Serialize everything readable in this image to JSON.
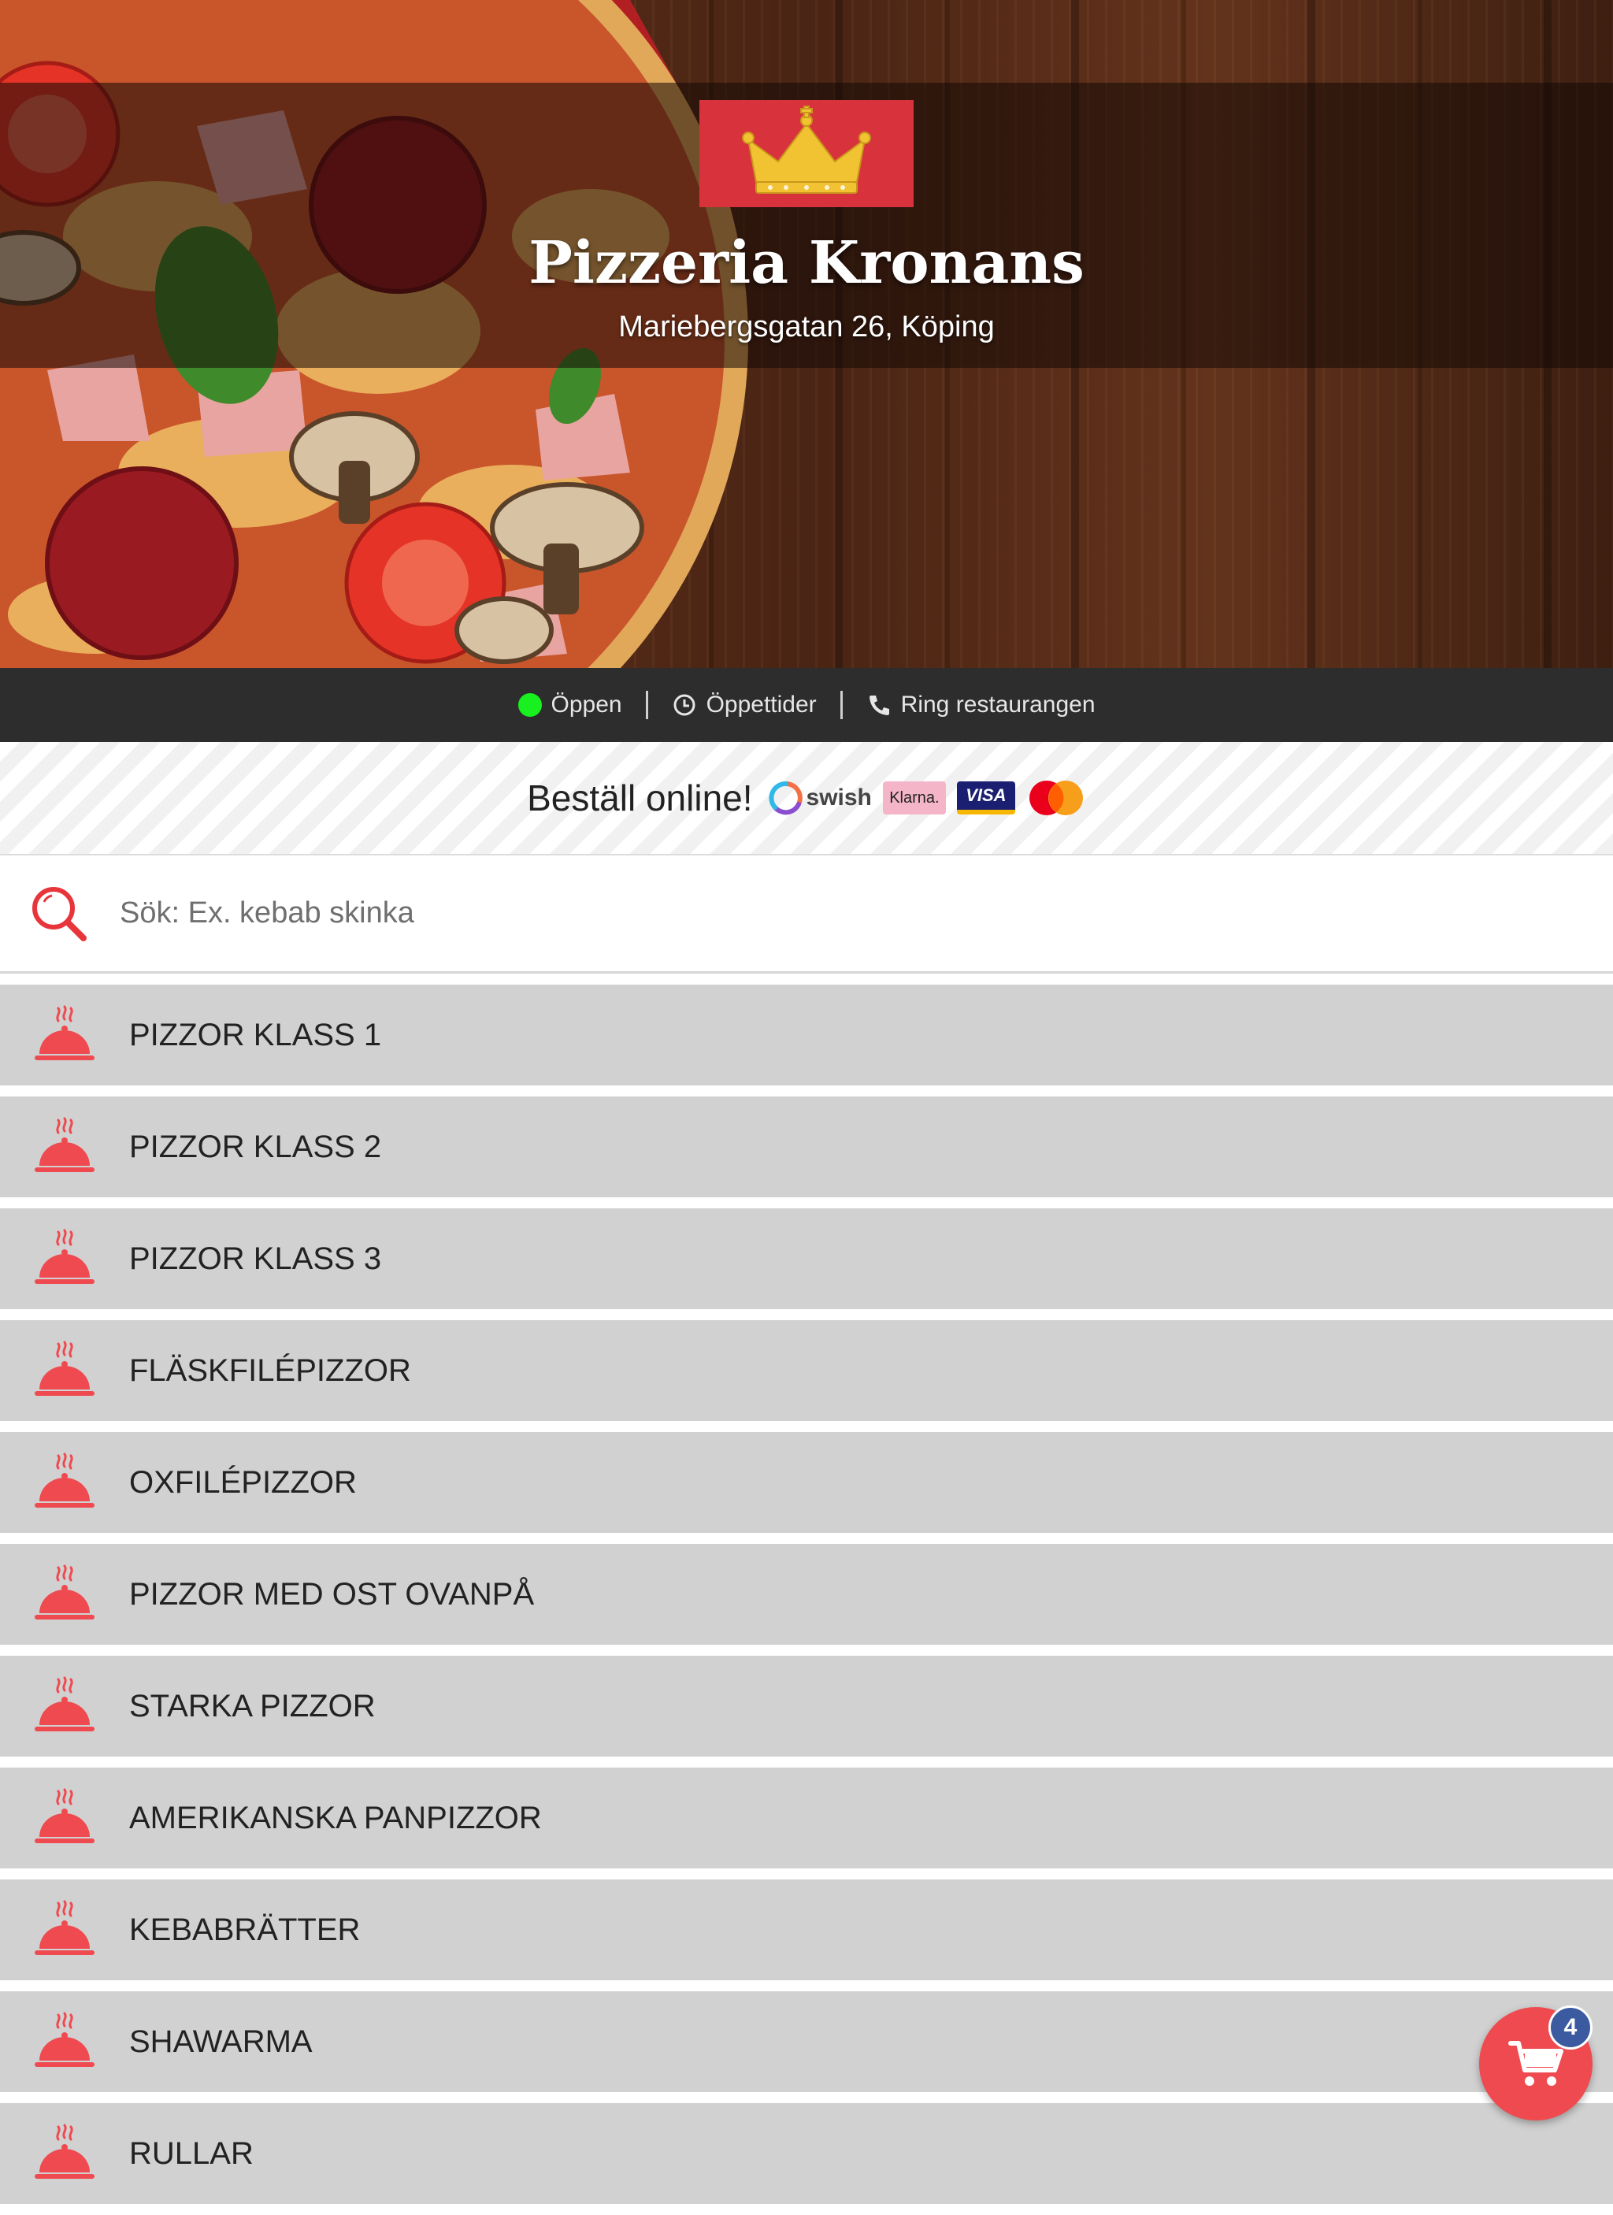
{
  "header": {
    "restaurant_name": "Pizzeria Kronans",
    "address": "Mariebergsgatan 26, Köping",
    "logo_icon": "crown-icon"
  },
  "info_bar": {
    "status_label": "Öppen",
    "status_color": "#18f020",
    "hours_label": "Öppettider",
    "call_label": "Ring restaurangen"
  },
  "order": {
    "label": "Beställ online!",
    "payment_methods": {
      "swish": "swish",
      "klarna": "Klarna.",
      "visa": "VISA",
      "mastercard": "mastercard"
    }
  },
  "search": {
    "placeholder": "Sök: Ex. kebab skinka",
    "value": ""
  },
  "categories": [
    {
      "label": "PIZZOR KLASS 1"
    },
    {
      "label": "PIZZOR KLASS 2"
    },
    {
      "label": "PIZZOR KLASS 3"
    },
    {
      "label": "FLÄSKFILÉPIZZOR"
    },
    {
      "label": "OXFILÉPIZZOR"
    },
    {
      "label": "PIZZOR MED OST OVANPÅ"
    },
    {
      "label": "STARKA PIZZOR"
    },
    {
      "label": "AMERIKANSKA PANPIZZOR"
    },
    {
      "label": "KEBABRÄTTER"
    },
    {
      "label": "SHAWARMA"
    },
    {
      "label": "RULLAR"
    }
  ],
  "cart": {
    "count": "4"
  },
  "colors": {
    "accent": "#ef4a4f",
    "brand": "#d8323c",
    "category_bg": "#d1d1d1",
    "info_bar_bg": "#2d2d2d",
    "badge": "#3b5aa0"
  }
}
